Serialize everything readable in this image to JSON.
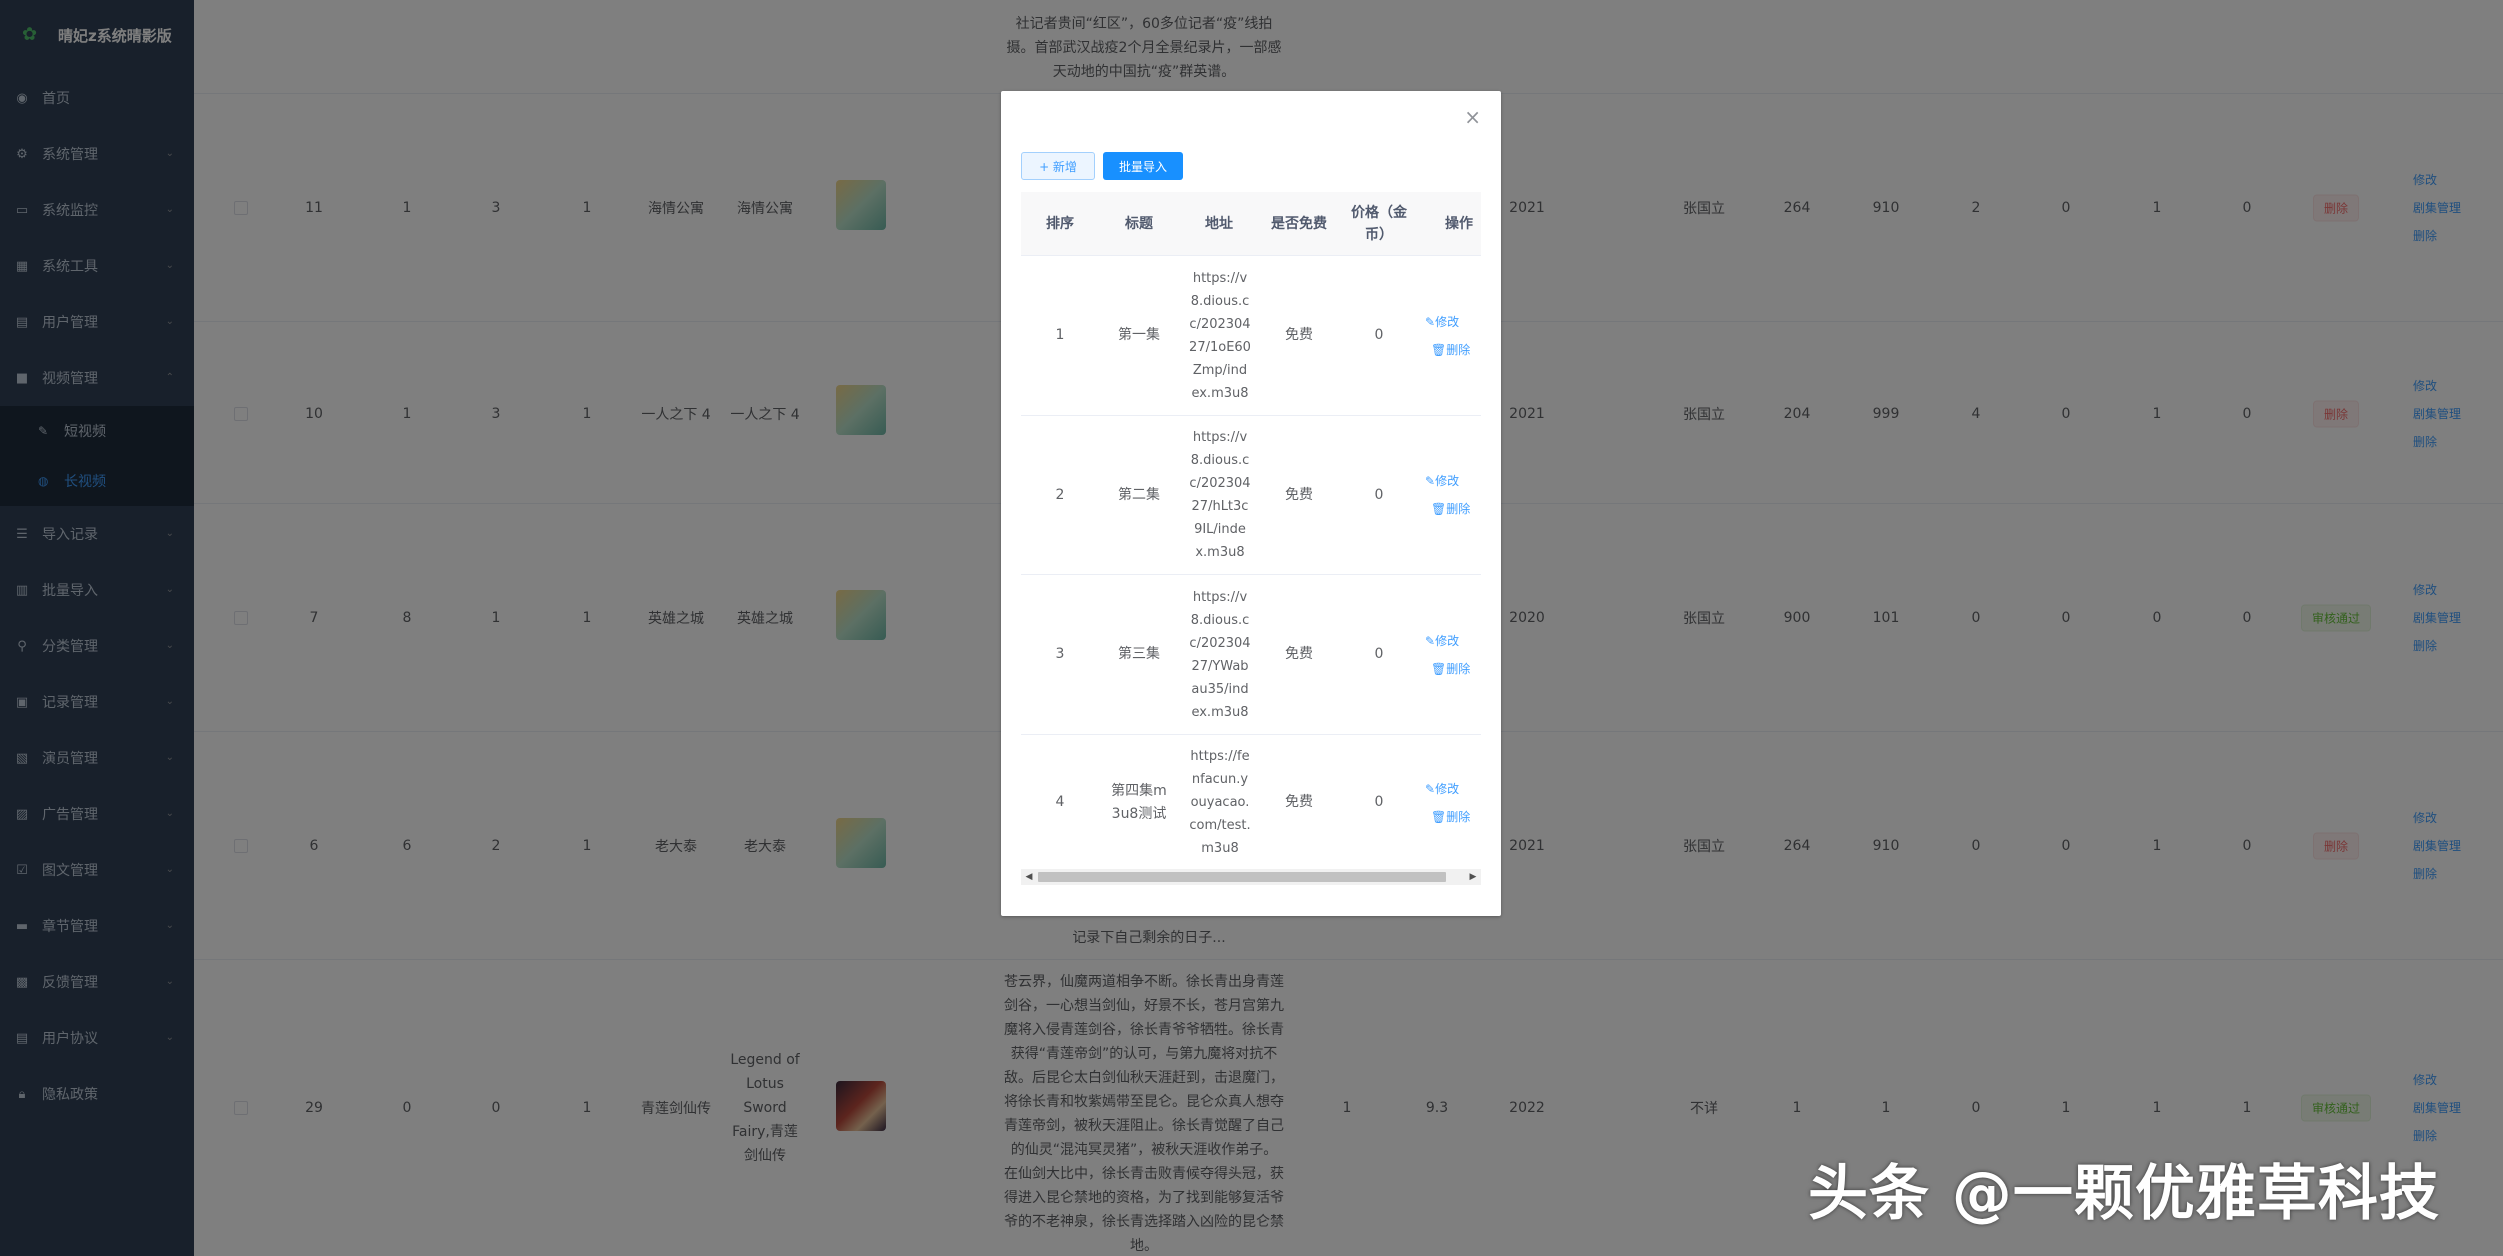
{
  "app": {
    "title": "晴妃z系统晴影版"
  },
  "sidebar": {
    "items": [
      {
        "label": "首页",
        "icon": "dashboard-icon"
      },
      {
        "label": "系统管理",
        "icon": "gear-icon"
      },
      {
        "label": "系统监控",
        "icon": "monitor-icon"
      },
      {
        "label": "系统工具",
        "icon": "tool-icon"
      },
      {
        "label": "用户管理",
        "icon": "user-icon"
      },
      {
        "label": "视频管理",
        "icon": "video-icon"
      }
    ],
    "subitems": [
      {
        "label": "短视频",
        "icon": "edit-icon"
      },
      {
        "label": "长视频",
        "icon": "film-icon"
      }
    ],
    "items_after": [
      {
        "label": "导入记录",
        "icon": "list-icon"
      },
      {
        "label": "批量导入",
        "icon": "import-icon"
      },
      {
        "label": "分类管理",
        "icon": "category-icon"
      },
      {
        "label": "记录管理",
        "icon": "record-icon"
      },
      {
        "label": "演员管理",
        "icon": "actor-icon"
      },
      {
        "label": "广告管理",
        "icon": "ad-icon"
      },
      {
        "label": "图文管理",
        "icon": "image-text-icon"
      },
      {
        "label": "章节管理",
        "icon": "chapter-icon"
      },
      {
        "label": "反馈管理",
        "icon": "feedback-icon"
      },
      {
        "label": "用户协议",
        "icon": "agreement-icon"
      },
      {
        "label": "隐私政策",
        "icon": "lock-icon"
      }
    ]
  },
  "background_table": {
    "top_desc": "社记者贵间“红区”，60多位记者“疫”线拍摄。首部武汉战疫2个月全景纪录片，一部感天动地的中国抗“疫”群英谱。",
    "rows": [
      {
        "id": "11",
        "c1": "1",
        "c2": "3",
        "c3": "1",
        "title": "海情公寓",
        "alias": "海情公寓",
        "year": "2021",
        "director": "张国立",
        "n1": "264",
        "n2": "910",
        "n3": "2",
        "n4": "0",
        "n5": "1",
        "n6": "0",
        "status": "删除",
        "ops": [
          "修改",
          "剧集管理",
          "删除"
        ]
      },
      {
        "id": "10",
        "c1": "1",
        "c2": "3",
        "c3": "1",
        "title": "一人之下 4",
        "alias": "一人之下 4",
        "year": "2021",
        "director": "张国立",
        "n1": "204",
        "n2": "999",
        "n3": "4",
        "n4": "0",
        "n5": "1",
        "n6": "0",
        "status": "删除",
        "ops": [
          "修改",
          "剧集管理",
          "删除"
        ]
      },
      {
        "id": "7",
        "c1": "8",
        "c2": "1",
        "c3": "1",
        "title": "英雄之城",
        "alias": "英雄之城",
        "year": "2020",
        "director": "张国立",
        "n1": "900",
        "n2": "101",
        "n3": "0",
        "n4": "0",
        "n5": "0",
        "n6": "0",
        "status": "审核通过",
        "ops": [
          "修改",
          "剧集管理",
          "删除"
        ]
      },
      {
        "id": "6",
        "c1": "6",
        "c2": "2",
        "c3": "1",
        "title": "老大泰",
        "alias": "老大泰",
        "year": "2021",
        "director": "张国立",
        "n1": "264",
        "n2": "910",
        "n3": "0",
        "n4": "0",
        "n5": "1",
        "n6": "0",
        "status": "删除",
        "ops": [
          "修改",
          "剧集管理",
          "删除"
        ]
      },
      {
        "id": "29",
        "c1": "0",
        "c2": "0",
        "c3": "1",
        "title": "青莲剑仙传",
        "alias": "Legend of Lotus Sword Fairy,青莲剑仙传",
        "extra1": "1",
        "extra2": "9.3",
        "year": "2022",
        "director": "不详",
        "n1": "1",
        "n2": "1",
        "n3": "0",
        "n4": "1",
        "n5": "1",
        "n6": "1",
        "status": "审核通过",
        "ops": [
          "修改",
          "剧集管理",
          "删除"
        ]
      }
    ],
    "row4_desc_tail": "记录下自己剩余的日子...",
    "row5_desc": "苍云界，仙魔两道相争不断。徐长青出身青莲剑谷，一心想当剑仙，好景不长，苍月宫第九魔将入侵青莲剑谷，徐长青爷爷牺牲。徐长青获得“青莲帝剑”的认可，与第九魔将对抗不敌。后昆仑太白剑仙秋天涯赶到，击退魔门，将徐长青和牧紫嫣带至昆仑。昆仑众真人想夺青莲帝剑，被秋天涯阻止。徐长青觉醒了自己的仙灵“混沌冥灵猪”，被秋天涯收作弟子。在仙剑大比中，徐长青击败青候夺得头冠，获得进入昆仑禁地的资格，为了找到能够复活爷爷的不老神泉，徐长青选择踏入凶险的昆仑禁地。"
  },
  "dialog": {
    "close_icon": "close-icon",
    "new_button": "+ 新增",
    "import_button": "批量导入",
    "columns": [
      "排序",
      "标题",
      "地址",
      "是否免费",
      "价格（金币）",
      "操作"
    ],
    "episodes": [
      {
        "order": "1",
        "title": "第一集",
        "url": "https://v8.dious.cc/20230427/1oE60Zmp/index.m3u8",
        "free": "免费",
        "price": "0",
        "edit": "修改",
        "delete": "删除"
      },
      {
        "order": "2",
        "title": "第二集",
        "url": "https://v8.dious.cc/20230427/hLt3c9IL/index.m3u8",
        "free": "免费",
        "price": "0",
        "edit": "修改",
        "delete": "删除"
      },
      {
        "order": "3",
        "title": "第三集",
        "url": "https://v8.dious.cc/20230427/YWabau35/index.m3u8",
        "free": "免费",
        "price": "0",
        "edit": "修改",
        "delete": "删除"
      },
      {
        "order": "4",
        "title": "第四集m3u8测试",
        "url": "https://fenfacun.youyacao.com/test.m3u8",
        "free": "免费",
        "price": "0",
        "edit": "修改",
        "delete": "删除"
      }
    ]
  },
  "watermark": "头条 @一颗优雅草科技",
  "colors": {
    "sidebar_bg": "#304156",
    "primary": "#1890ff",
    "link": "#409eff",
    "danger": "#f56c6c",
    "success": "#67c23a"
  }
}
